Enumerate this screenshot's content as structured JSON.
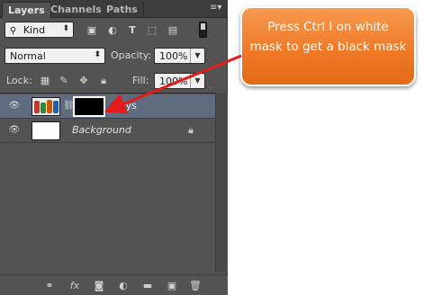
{
  "panel": {
    "tabs": [
      {
        "label": "Layers",
        "active": true
      },
      {
        "label": "Channels",
        "active": false
      },
      {
        "label": "Paths",
        "active": false
      }
    ],
    "menu_icon": "panel-menu-icon",
    "filter": {
      "kind_label": "Kind",
      "search_icon": "search-icon",
      "filter_icons": [
        "image-filter-icon",
        "adjustment-filter-icon",
        "type-filter-icon",
        "shape-filter-icon",
        "smart-object-filter-icon"
      ]
    },
    "blend_mode": "Normal",
    "opacity_label": "Opacity:",
    "opacity_value": "100%",
    "lock_label": "Lock:",
    "lock_icons": [
      "lock-transparent-icon",
      "lock-image-icon",
      "lock-position-icon",
      "lock-all-icon"
    ],
    "fill_label": "Fill:",
    "fill_value": "100%",
    "layers": [
      {
        "name": "Toys",
        "selected": true,
        "visible": true,
        "has_mask": true,
        "mask_color": "#000000"
      },
      {
        "name": "Background",
        "selected": false,
        "visible": true,
        "locked": true
      }
    ],
    "footer_icons": [
      "link-layers-icon",
      "fx-icon",
      "add-mask-icon",
      "adjustment-layer-icon",
      "group-folder-icon",
      "new-layer-icon",
      "trash-icon"
    ],
    "footer_fx_label": "fx"
  },
  "callout": {
    "text": "Press Ctrl I on white mask to get a black mask",
    "color": "#ef7a27",
    "arrow_color": "#e41b1b"
  }
}
